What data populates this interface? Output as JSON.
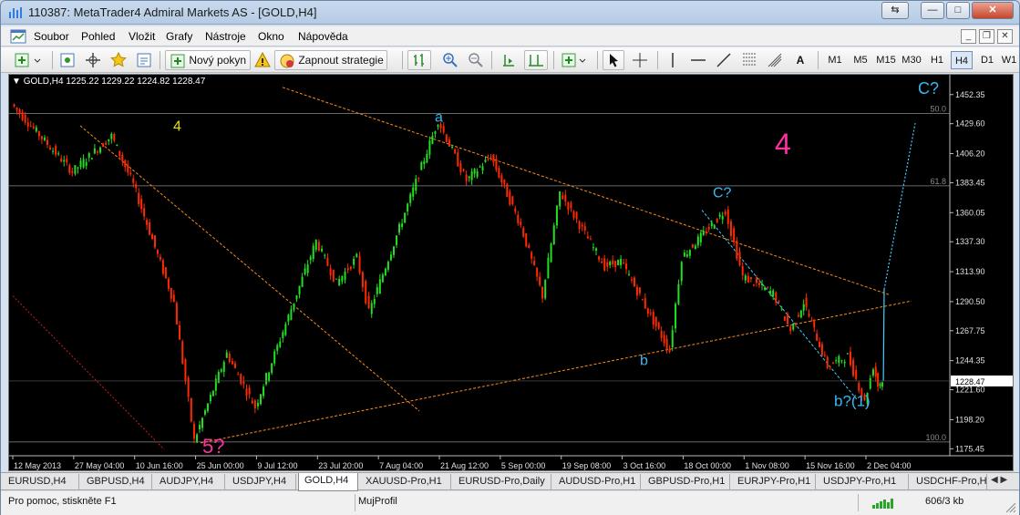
{
  "window": {
    "title": "110387: MetaTrader4 Admiral Markets AS - [GOLD,H4]",
    "controls": [
      "⇆",
      "—",
      "□",
      "✕"
    ]
  },
  "menu": {
    "items": [
      "Soubor",
      "Pohled",
      "Vložit",
      "Grafy",
      "Nástroje",
      "Okno",
      "Nápověda"
    ],
    "mdi_controls": [
      "_",
      "❐",
      "✕"
    ]
  },
  "toolbar": {
    "new_order_label": "Nový pokyn",
    "autotrading_label": "Zapnout strategie",
    "timeframes": [
      "M1",
      "M5",
      "M15",
      "M30",
      "H1",
      "H4",
      "D1",
      "W1"
    ],
    "active_timeframe": "H4",
    "text_tool_label": "A"
  },
  "chart": {
    "header": "GOLD,H4  1225.22 1229.22 1224.82 1228.47",
    "price_axis": [
      "1452.35",
      "1429.60",
      "1406.20",
      "1383.45",
      "1360.05",
      "1337.30",
      "1313.90",
      "1290.50",
      "1267.75",
      "1244.35",
      "1221.60",
      "1198.20",
      "1175.45"
    ],
    "current_price": "1228.47",
    "date_axis": [
      "12 May 2013",
      "27 May 04:00",
      "10 Jun 16:00",
      "25 Jun 00:00",
      "9 Jul 12:00",
      "23 Jul 20:00",
      "7 Aug 04:00",
      "21 Aug 12:00",
      "5 Sep 00:00",
      "19 Sep 08:00",
      "3 Oct 16:00",
      "18 Oct 00:00",
      "1 Nov 08:00",
      "15 Nov 16:00",
      "2 Dec 04:00"
    ],
    "fibo_levels": [
      {
        "label": "50.0",
        "price": 1437.5
      },
      {
        "label": "61.8",
        "price": 1381.0
      },
      {
        "label": "100.0",
        "price": 1180.8
      }
    ],
    "annotations": [
      {
        "text": "4",
        "color": "#e8e000"
      },
      {
        "text": "a",
        "color": "#39b8f0"
      },
      {
        "text": "4",
        "color": "#ff2fa0"
      },
      {
        "text": "C?",
        "color": "#39b8f0"
      },
      {
        "text": "b",
        "color": "#39b8f0"
      },
      {
        "text": "C?",
        "color": "#39b8f0"
      },
      {
        "text": "b?(1)",
        "color": "#39b8f0"
      },
      {
        "text": "5?",
        "color": "#ff2fa0"
      }
    ],
    "colors": {
      "bull": "#20e020",
      "bear": "#ff2a00",
      "trendline": "#ff8a1a",
      "projection": "#3fd0ff"
    }
  },
  "chart_data": {
    "type": "candlestick",
    "symbol": "GOLD",
    "timeframe": "H4",
    "ylim": [
      1170,
      1465
    ],
    "swing_path": [
      [
        "12 May 2013",
        1445
      ],
      [
        "27 May 04:00",
        1392
      ],
      [
        "5 Jun 08:00",
        1420
      ],
      [
        "10 Jun 16:00",
        1382
      ],
      [
        "20 Jun 00:00",
        1290
      ],
      [
        "25 Jun 00:00",
        1182
      ],
      [
        "2 Jul 00:00",
        1250
      ],
      [
        "9 Jul 12:00",
        1208
      ],
      [
        "23 Jul 20:00",
        1338
      ],
      [
        "28 Jul 08:00",
        1305
      ],
      [
        "2 Aug 00:00",
        1325
      ],
      [
        "5 Aug 00:00",
        1282
      ],
      [
        "21 Aug 12:00",
        1432
      ],
      [
        "28 Aug 00:00",
        1385
      ],
      [
        "3 Sep 00:00",
        1404
      ],
      [
        "10 Sep 00:00",
        1350
      ],
      [
        "15 Sep 00:00",
        1295
      ],
      [
        "19 Sep 08:00",
        1376
      ],
      [
        "30 Sep 00:00",
        1318
      ],
      [
        "3 Oct 16:00",
        1322
      ],
      [
        "15 Oct 00:00",
        1252
      ],
      [
        "18 Oct 00:00",
        1325
      ],
      [
        "28 Oct 00:00",
        1362
      ],
      [
        "1 Nov 08:00",
        1310
      ],
      [
        "8 Nov 00:00",
        1297
      ],
      [
        "12 Nov 00:00",
        1268
      ],
      [
        "15 Nov 16:00",
        1290
      ],
      [
        "22 Nov 00:00",
        1240
      ],
      [
        "28 Nov 00:00",
        1248
      ],
      [
        "2 Dec 04:00",
        1212
      ],
      [
        "4 Dec 00:00",
        1240
      ],
      [
        "5 Dec 00:00",
        1225
      ],
      [
        "6 Dec 00:00",
        1228.47
      ]
    ]
  },
  "tabs": [
    "EURUSD,H4",
    "GBPUSD,H4",
    "AUDJPY,H4",
    "USDJPY,H4",
    "GOLD,H4",
    "XAUUSD-Pro,H1",
    "EURUSD-Pro,Daily",
    "AUDUSD-Pro,H1",
    "GBPUSD-Pro,H1",
    "EURJPY-Pro,H1",
    "USDJPY-Pro,H1",
    "USDCHF-Pro,H"
  ],
  "active_tab": "GOLD,H4",
  "status": {
    "help": "Pro pomoc, stiskněte F1",
    "profile": "MujProfil",
    "traffic": "606/3 kb"
  }
}
